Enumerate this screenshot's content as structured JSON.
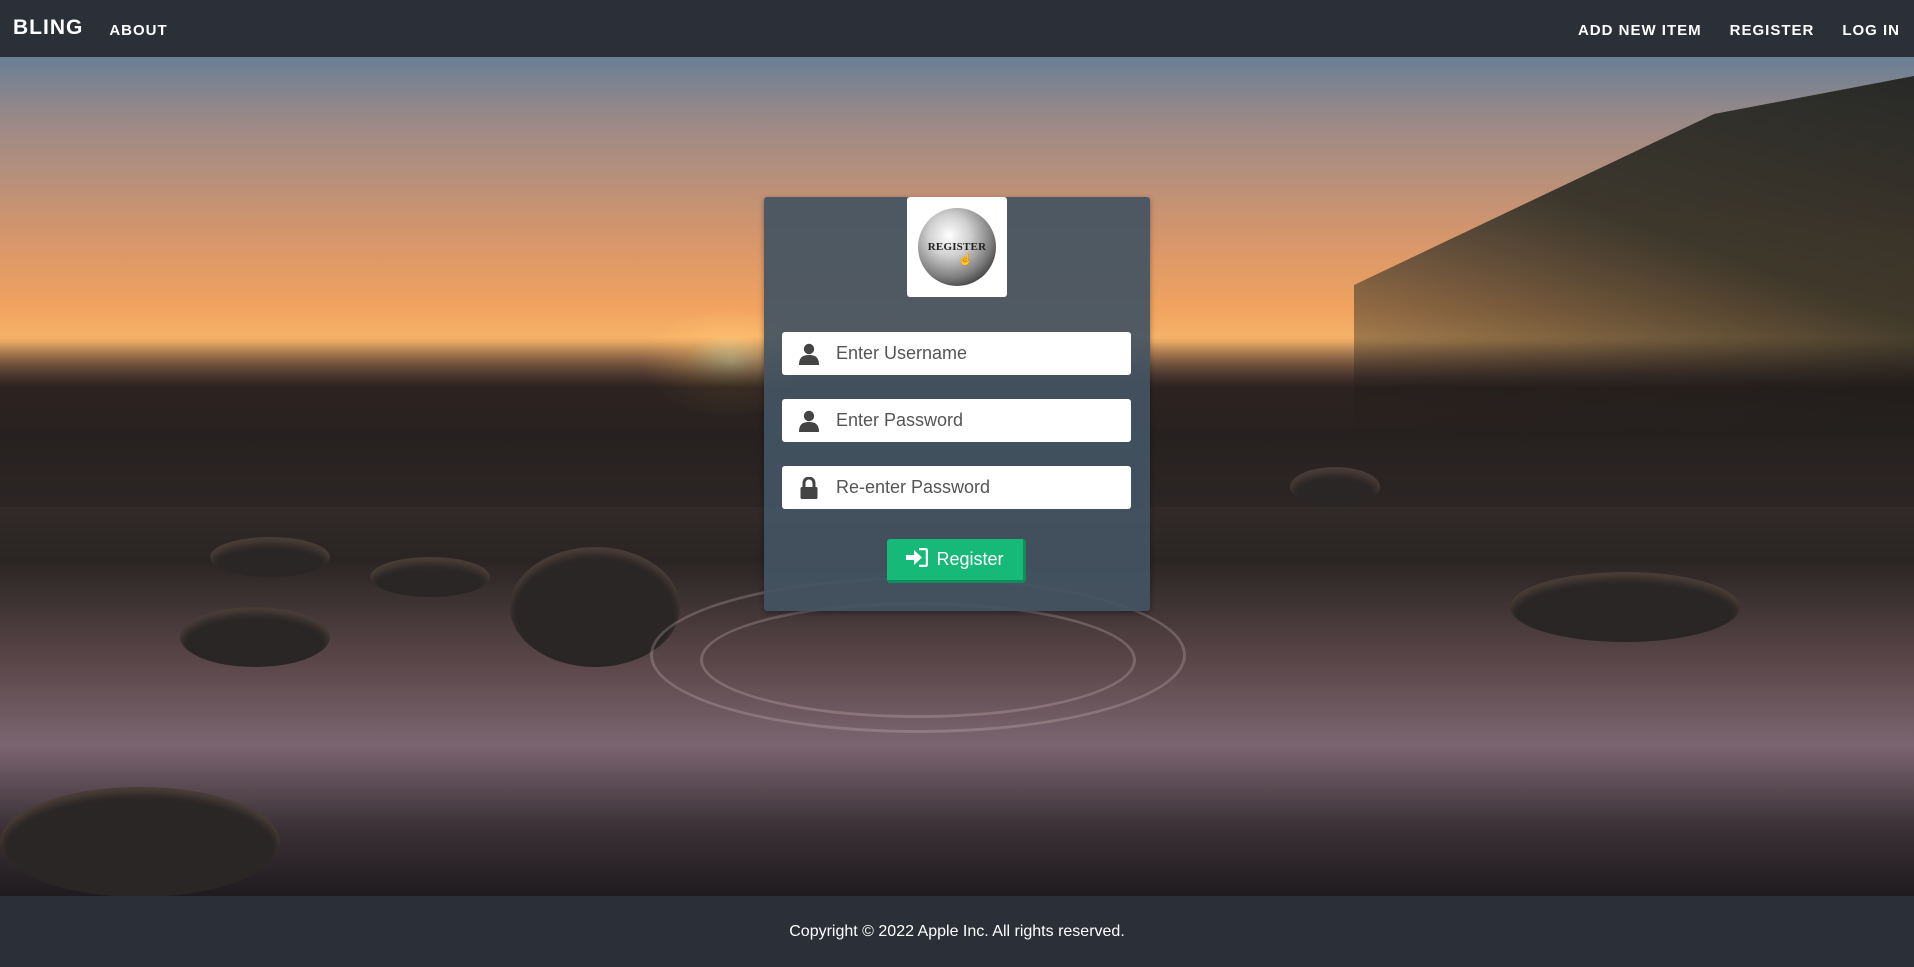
{
  "navbar": {
    "brand": "BLING",
    "about": "ABOUT",
    "add_new_item": "ADD NEW ITEM",
    "register": "REGISTER",
    "log_in": "LOG IN"
  },
  "form": {
    "logo_text": "REGISTER",
    "username": {
      "placeholder": "Enter Username",
      "icon": "user-icon"
    },
    "password": {
      "placeholder": "Enter Password",
      "icon": "user-icon"
    },
    "confirm_password": {
      "placeholder": "Re-enter Password",
      "icon": "lock-icon"
    },
    "submit_label": "Register",
    "submit_icon": "sign-in-icon"
  },
  "footer": {
    "copyright": "Copyright © 2022 Apple Inc. All rights reserved."
  },
  "colors": {
    "navbar_bg": "#2b3038",
    "card_bg": "#445462",
    "button_green": "#17b978"
  }
}
